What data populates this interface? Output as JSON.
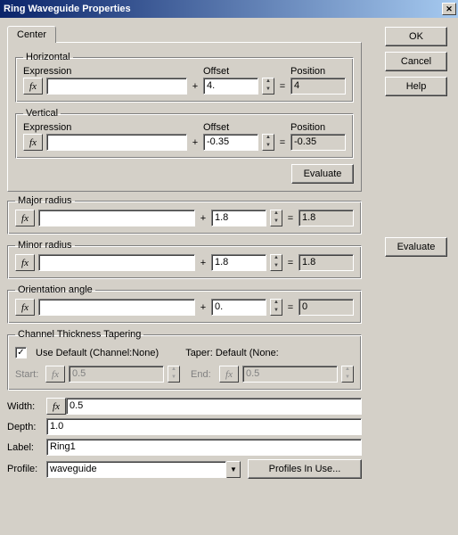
{
  "title": "Ring Waveguide Properties",
  "buttons": {
    "ok": "OK",
    "cancel": "Cancel",
    "help": "Help",
    "evaluate": "Evaluate",
    "profiles": "Profiles In Use..."
  },
  "tab": "Center",
  "labels": {
    "horizontal": "Horizontal",
    "vertical": "Vertical",
    "expression": "Expression",
    "offset": "Offset",
    "position": "Position",
    "major": "Major radius",
    "minor": "Minor radius",
    "orient": "Orientation angle",
    "ctt": "Channel Thickness Tapering",
    "useDefault": "Use Default (Channel:None)",
    "taper": "Taper:  Default (None:",
    "start": "Start:",
    "end": "End:",
    "width": "Width:",
    "depth": "Depth:",
    "labelL": "Label:",
    "profile": "Profile:",
    "fx": "fx",
    "plus": "+",
    "eq": "="
  },
  "center": {
    "h": {
      "expr": "",
      "offset": "4.",
      "pos": "4"
    },
    "v": {
      "expr": "",
      "offset": "-0.35",
      "pos": "-0.35"
    }
  },
  "major": {
    "expr": "",
    "offset": "1.8",
    "pos": "1.8"
  },
  "minor": {
    "expr": "",
    "offset": "1.8",
    "pos": "1.8"
  },
  "orient": {
    "expr": "",
    "offset": "0.",
    "pos": "0"
  },
  "taperStart": "0.5",
  "taperEnd": "0.5",
  "check": "✓",
  "width": "0.5",
  "depth": "1.0",
  "label": "Ring1",
  "profileSel": "waveguide"
}
